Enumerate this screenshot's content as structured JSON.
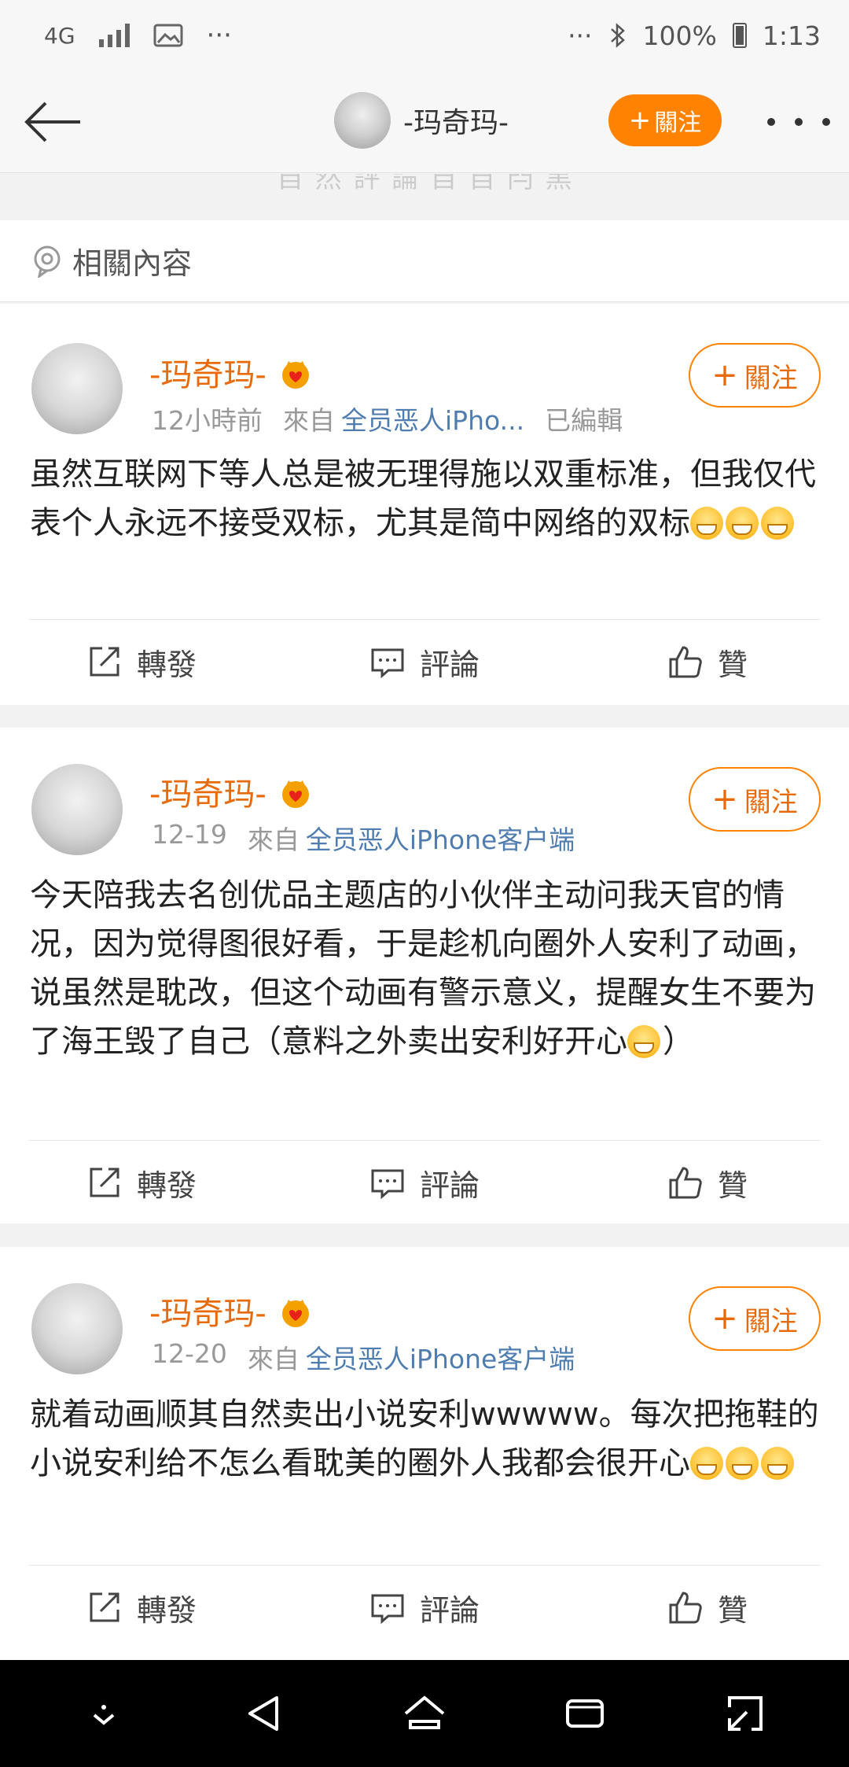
{
  "status_bar": {
    "network": "4G",
    "dots": "···",
    "right_dots": "···",
    "battery_text": "100%",
    "time": "1:13"
  },
  "nav": {
    "title": "-玛奇玛-",
    "follow_label": "關注",
    "follow_plus": "+"
  },
  "peek_text": "自 然 評 論   自 自 閂 黑",
  "related": {
    "label": "相關內容"
  },
  "actions": {
    "repost": "轉發",
    "comment": "評論",
    "like": "贊"
  },
  "posts": [
    {
      "name": "-玛奇玛-",
      "time": "12小時前",
      "from": "來自",
      "source": "全员恶人iPho...",
      "edited": "已編輯",
      "follow": "關注",
      "text": "虽然互联网下等人总是被无理得施以双重标准，但我仅代表个人永远不接受双标，尤其是简中网络的双标",
      "emoji_count": 3
    },
    {
      "name": "-玛奇玛-",
      "time": "12-19",
      "from": "來自",
      "source": "全员恶人iPhone客户端",
      "edited": "",
      "follow": "關注",
      "text": "今天陪我去名创优品主题店的小伙伴主动问我天官的情况，因为觉得图很好看，于是趁机向圈外人安利了动画，说虽然是耽改，但这个动画有警示意义，提醒女生不要为了海王毁了自己（意料之外卖出安利好开心",
      "text_tail": "）",
      "emoji_count": 1
    },
    {
      "name": "-玛奇玛-",
      "time": "12-20",
      "from": "來自",
      "source": "全员恶人iPhone客户端",
      "edited": "",
      "follow": "關注",
      "text": "就着动画顺其自然卖出小说安利wwwww。每次把拖鞋的小说安利给不怎么看耽美的圈外人我都会很开心",
      "emoji_count": 3
    }
  ],
  "colors": {
    "accent": "#ff8200",
    "name": "#e86b0b",
    "link": "#507daf"
  }
}
